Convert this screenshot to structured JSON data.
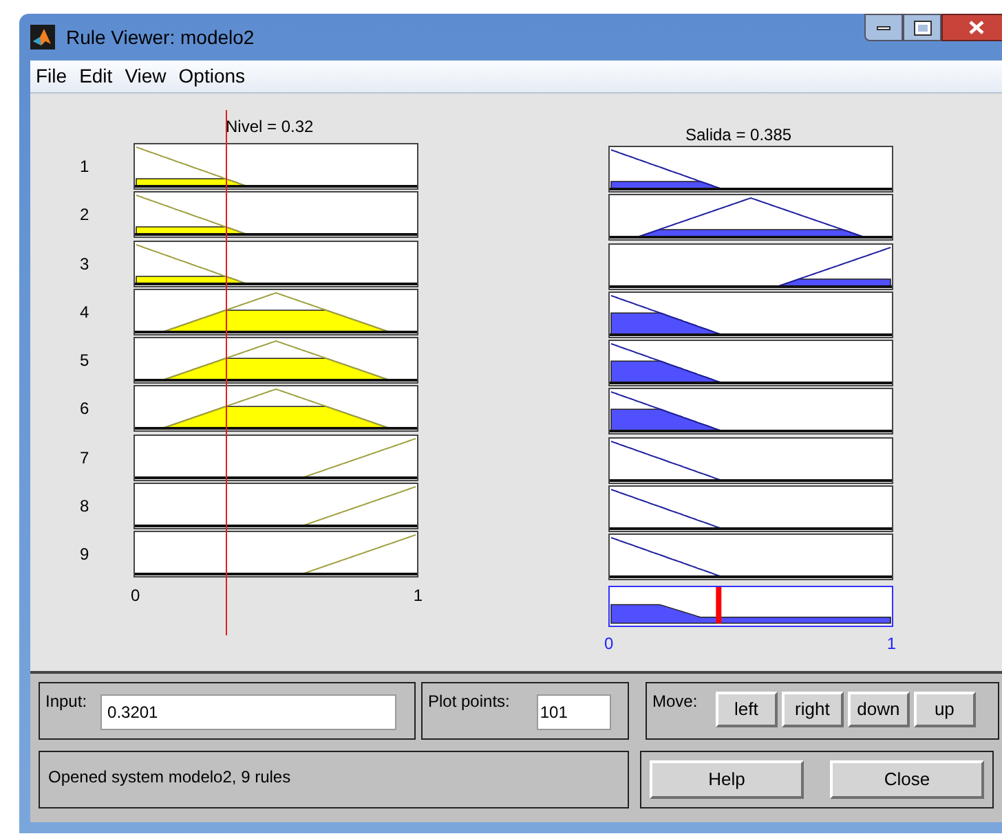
{
  "window": {
    "title": "Rule Viewer: modelo2"
  },
  "menu": [
    "File",
    "Edit",
    "View",
    "Options"
  ],
  "input": {
    "label": "Nivel = 0.32",
    "level": 0.32,
    "axis": [
      "0",
      "1"
    ]
  },
  "output": {
    "label": "Salida = 0.385",
    "level": 0.385,
    "axis": [
      "0",
      "1"
    ]
  },
  "rules": [
    {
      "number": "1",
      "input": {
        "kind": "low"
      },
      "output": {
        "kind": "low"
      }
    },
    {
      "number": "2",
      "input": {
        "kind": "low"
      },
      "output": {
        "kind": "mid"
      }
    },
    {
      "number": "3",
      "input": {
        "kind": "low"
      },
      "output": {
        "kind": "high"
      }
    },
    {
      "number": "4",
      "input": {
        "kind": "mid"
      },
      "output": {
        "kind": "low"
      }
    },
    {
      "number": "5",
      "input": {
        "kind": "mid"
      },
      "output": {
        "kind": "low"
      }
    },
    {
      "number": "6",
      "input": {
        "kind": "mid"
      },
      "output": {
        "kind": "low"
      }
    },
    {
      "number": "7",
      "input": {
        "kind": "high"
      },
      "output": {
        "kind": "low"
      }
    },
    {
      "number": "8",
      "input": {
        "kind": "high"
      },
      "output": {
        "kind": "low"
      }
    },
    {
      "number": "9",
      "input": {
        "kind": "high"
      },
      "output": {
        "kind": "low"
      }
    }
  ],
  "controls": {
    "input_label": "Input:",
    "input_value": "0.3201",
    "plot_points_label": "Plot points:",
    "plot_points_value": "101",
    "move_label": "Move:",
    "move_buttons": [
      "left",
      "right",
      "down",
      "up"
    ]
  },
  "status": "Opened system modelo2, 9 rules",
  "buttons": [
    "Help",
    "Close"
  ]
}
